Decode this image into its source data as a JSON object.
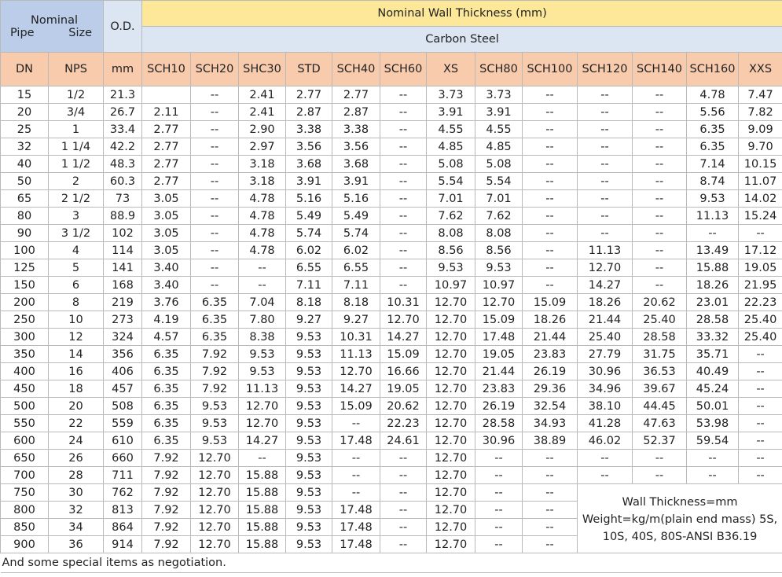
{
  "header": {
    "nominal_top": "Nominal",
    "nominal_pipe": "Pipe",
    "nominal_size": "Size",
    "od": "O.D.",
    "wall_title": "Nominal Wall Thickness (mm)",
    "material": "Carbon Steel"
  },
  "columns": [
    "DN",
    "NPS",
    "mm",
    "SCH10",
    "SCH20",
    "SHC30",
    "STD",
    "SCH40",
    "SCH60",
    "XS",
    "SCH80",
    "SCH100",
    "SCH120",
    "SCH140",
    "SCH160",
    "XXS"
  ],
  "rows": [
    [
      "15",
      "1/2",
      "21.3",
      "",
      "--",
      "2.41",
      "2.77",
      "2.77",
      "--",
      "3.73",
      "3.73",
      "--",
      "--",
      "--",
      "4.78",
      "7.47"
    ],
    [
      "20",
      "3/4",
      "26.7",
      "2.11",
      "--",
      "2.41",
      "2.87",
      "2.87",
      "--",
      "3.91",
      "3.91",
      "--",
      "--",
      "--",
      "5.56",
      "7.82"
    ],
    [
      "25",
      "1",
      "33.4",
      "2.77",
      "--",
      "2.90",
      "3.38",
      "3.38",
      "--",
      "4.55",
      "4.55",
      "--",
      "--",
      "--",
      "6.35",
      "9.09"
    ],
    [
      "32",
      "1 1/4",
      "42.2",
      "2.77",
      "--",
      "2.97",
      "3.56",
      "3.56",
      "--",
      "4.85",
      "4.85",
      "--",
      "--",
      "--",
      "6.35",
      "9.70"
    ],
    [
      "40",
      "1 1/2",
      "48.3",
      "2.77",
      "--",
      "3.18",
      "3.68",
      "3.68",
      "--",
      "5.08",
      "5.08",
      "--",
      "--",
      "--",
      "7.14",
      "10.15"
    ],
    [
      "50",
      "2",
      "60.3",
      "2.77",
      "--",
      "3.18",
      "3.91",
      "3.91",
      "--",
      "5.54",
      "5.54",
      "--",
      "--",
      "--",
      "8.74",
      "11.07"
    ],
    [
      "65",
      "2 1/2",
      "73",
      "3.05",
      "--",
      "4.78",
      "5.16",
      "5.16",
      "--",
      "7.01",
      "7.01",
      "--",
      "--",
      "--",
      "9.53",
      "14.02"
    ],
    [
      "80",
      "3",
      "88.9",
      "3.05",
      "--",
      "4.78",
      "5.49",
      "5.49",
      "--",
      "7.62",
      "7.62",
      "--",
      "--",
      "--",
      "11.13",
      "15.24"
    ],
    [
      "90",
      "3 1/2",
      "102",
      "3.05",
      "--",
      "4.78",
      "5.74",
      "5.74",
      "--",
      "8.08",
      "8.08",
      "--",
      "--",
      "--",
      "--",
      "--"
    ],
    [
      "100",
      "4",
      "114",
      "3.05",
      "--",
      "4.78",
      "6.02",
      "6.02",
      "--",
      "8.56",
      "8.56",
      "--",
      "11.13",
      "--",
      "13.49",
      "17.12"
    ],
    [
      "125",
      "5",
      "141",
      "3.40",
      "--",
      "--",
      "6.55",
      "6.55",
      "--",
      "9.53",
      "9.53",
      "--",
      "12.70",
      "--",
      "15.88",
      "19.05"
    ],
    [
      "150",
      "6",
      "168",
      "3.40",
      "--",
      "--",
      "7.11",
      "7.11",
      "--",
      "10.97",
      "10.97",
      "--",
      "14.27",
      "--",
      "18.26",
      "21.95"
    ],
    [
      "200",
      "8",
      "219",
      "3.76",
      "6.35",
      "7.04",
      "8.18",
      "8.18",
      "10.31",
      "12.70",
      "12.70",
      "15.09",
      "18.26",
      "20.62",
      "23.01",
      "22.23"
    ],
    [
      "250",
      "10",
      "273",
      "4.19",
      "6.35",
      "7.80",
      "9.27",
      "9.27",
      "12.70",
      "12.70",
      "15.09",
      "18.26",
      "21.44",
      "25.40",
      "28.58",
      "25.40"
    ],
    [
      "300",
      "12",
      "324",
      "4.57",
      "6.35",
      "8.38",
      "9.53",
      "10.31",
      "14.27",
      "12.70",
      "17.48",
      "21.44",
      "25.40",
      "28.58",
      "33.32",
      "25.40"
    ],
    [
      "350",
      "14",
      "356",
      "6.35",
      "7.92",
      "9.53",
      "9.53",
      "11.13",
      "15.09",
      "12.70",
      "19.05",
      "23.83",
      "27.79",
      "31.75",
      "35.71",
      "--"
    ],
    [
      "400",
      "16",
      "406",
      "6.35",
      "7.92",
      "9.53",
      "9.53",
      "12.70",
      "16.66",
      "12.70",
      "21.44",
      "26.19",
      "30.96",
      "36.53",
      "40.49",
      "--"
    ],
    [
      "450",
      "18",
      "457",
      "6.35",
      "7.92",
      "11.13",
      "9.53",
      "14.27",
      "19.05",
      "12.70",
      "23.83",
      "29.36",
      "34.96",
      "39.67",
      "45.24",
      "--"
    ],
    [
      "500",
      "20",
      "508",
      "6.35",
      "9.53",
      "12.70",
      "9.53",
      "15.09",
      "20.62",
      "12.70",
      "26.19",
      "32.54",
      "38.10",
      "44.45",
      "50.01",
      "--"
    ],
    [
      "550",
      "22",
      "559",
      "6.35",
      "9.53",
      "12.70",
      "9.53",
      "--",
      "22.23",
      "12.70",
      "28.58",
      "34.93",
      "41.28",
      "47.63",
      "53.98",
      "--"
    ],
    [
      "600",
      "24",
      "610",
      "6.35",
      "9.53",
      "14.27",
      "9.53",
      "17.48",
      "24.61",
      "12.70",
      "30.96",
      "38.89",
      "46.02",
      "52.37",
      "59.54",
      "--"
    ],
    [
      "650",
      "26",
      "660",
      "7.92",
      "12.70",
      "--",
      "9.53",
      "--",
      "--",
      "12.70",
      "--",
      "--",
      "--",
      "--",
      "--",
      "--"
    ],
    [
      "700",
      "28",
      "711",
      "7.92",
      "12.70",
      "15.88",
      "9.53",
      "--",
      "--",
      "12.70",
      "--",
      "--",
      "--",
      "--",
      "--",
      "--"
    ]
  ],
  "rows_short": [
    [
      "750",
      "30",
      "762",
      "7.92",
      "12.70",
      "15.88",
      "9.53",
      "--",
      "--",
      "12.70",
      "--",
      "--"
    ],
    [
      "800",
      "32",
      "813",
      "7.92",
      "12.70",
      "15.88",
      "9.53",
      "17.48",
      "--",
      "12.70",
      "--",
      "--"
    ],
    [
      "850",
      "34",
      "864",
      "7.92",
      "12.70",
      "15.88",
      "9.53",
      "17.48",
      "--",
      "12.70",
      "--",
      "--"
    ],
    [
      "900",
      "36",
      "914",
      "7.92",
      "12.70",
      "15.88",
      "9.53",
      "17.48",
      "--",
      "12.70",
      "--",
      "--"
    ]
  ],
  "note": {
    "line1": "Wall Thickness=mm",
    "line2": "Weight=kg/m(plain end mass)   5S,",
    "line3": "10S, 40S, 80S-ANSI B36.19"
  },
  "footer": "And some special items as negotiation.",
  "colors": {
    "header_blue": "#bccde9",
    "header_yellow": "#fde89a",
    "header_light_blue": "#dce6f2",
    "header_pink": "#f8cbad"
  }
}
